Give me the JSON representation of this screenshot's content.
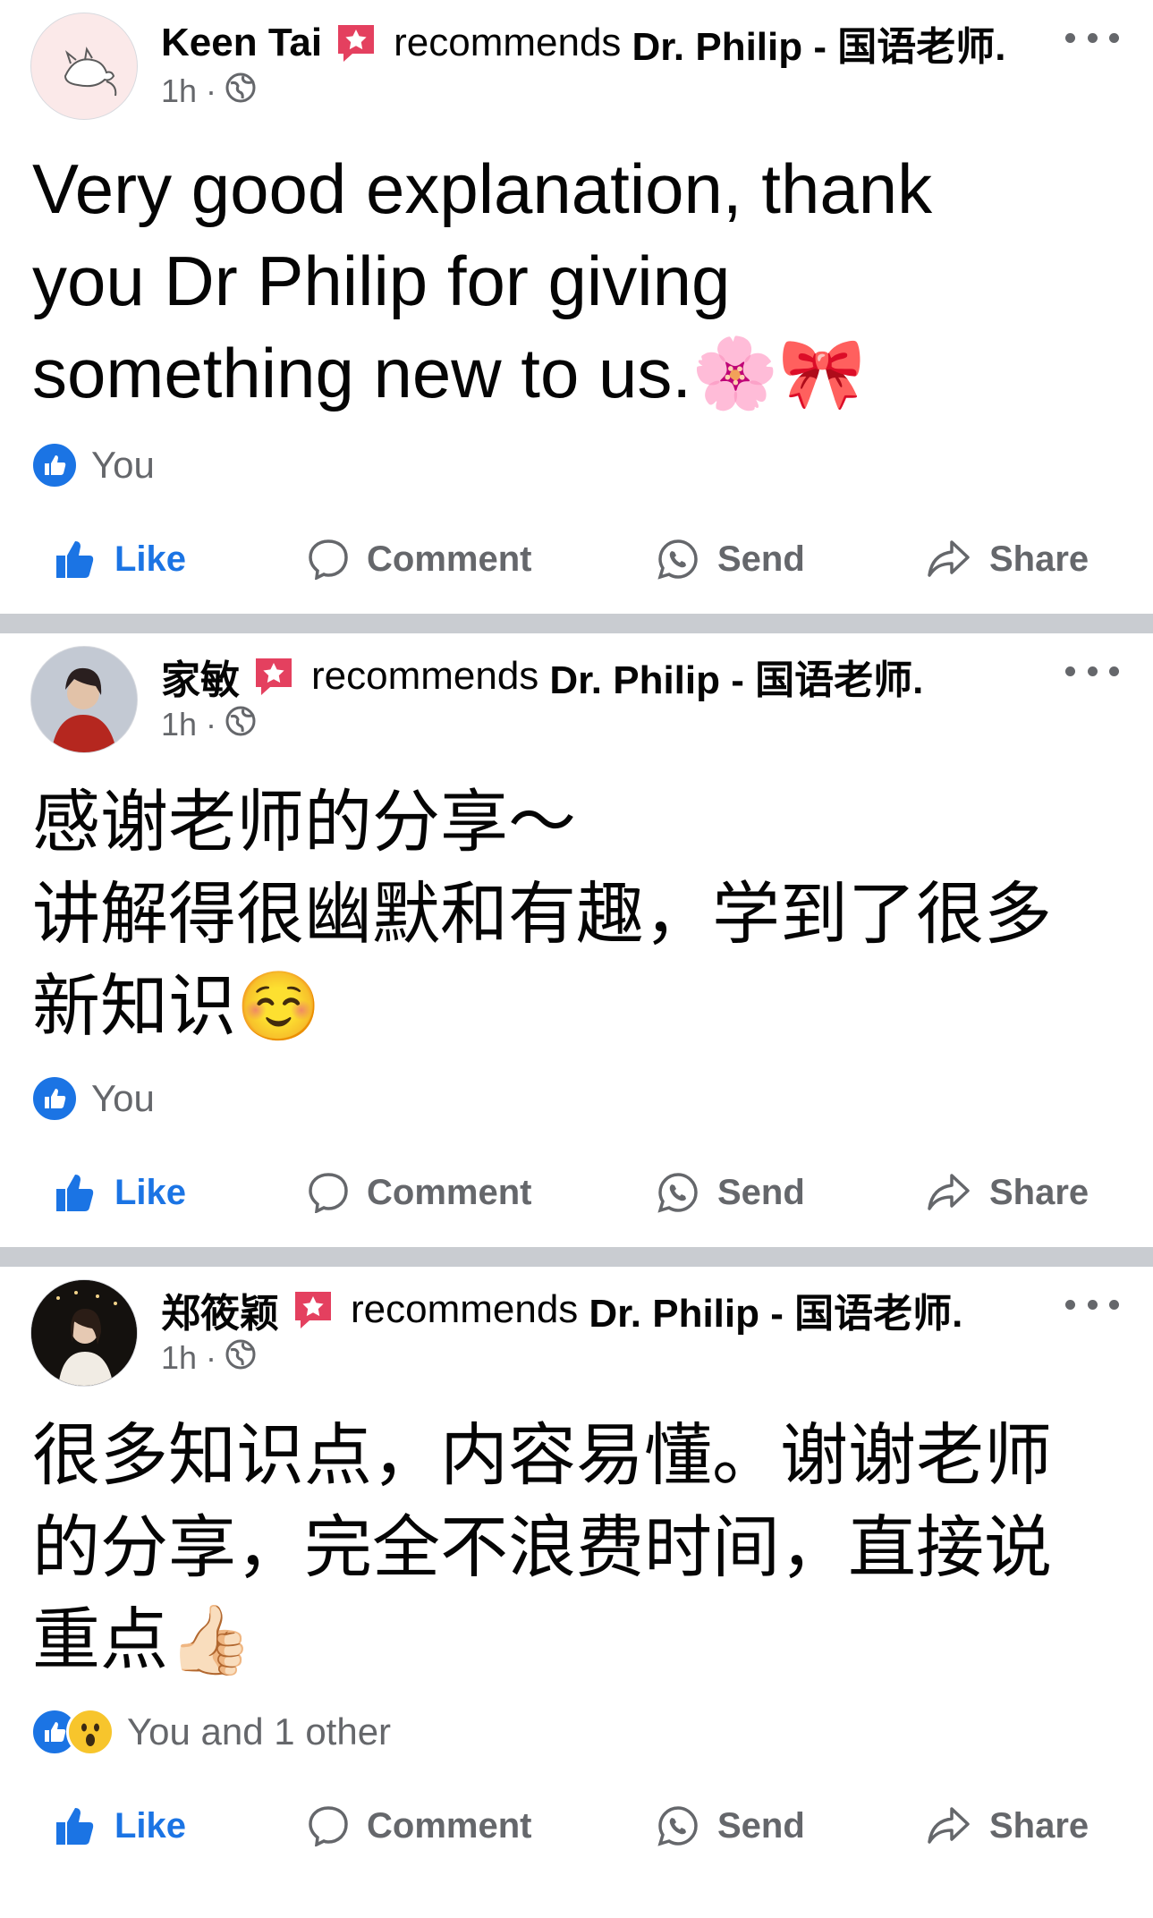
{
  "colors": {
    "like_blue": "#1b74e4",
    "gray_text": "#65676b",
    "badge_red": "#e4405f",
    "divider": "#c9ccd1"
  },
  "common": {
    "verb": "recommends",
    "page": "Dr. Philip - 国语老师.",
    "dot": "·"
  },
  "posts": [
    {
      "author": "Keen Tai",
      "time": "1h",
      "text": "Very good explanation, thank\nyou Dr Philip for giving\nsomething new to us.🌸🎀",
      "reactions": [
        "like"
      ],
      "reaction_text": "You",
      "actions": {
        "like": "Like",
        "comment": "Comment",
        "send": "Send",
        "share": "Share"
      }
    },
    {
      "author": "家敏",
      "time": "1h",
      "text": "感谢老师的分享～\n讲解得很幽默和有趣，学到了很多\n新知识☺️",
      "reactions": [
        "like"
      ],
      "reaction_text": "You",
      "actions": {
        "like": "Like",
        "comment": "Comment",
        "send": "Send",
        "share": "Share"
      }
    },
    {
      "author": "郑筱颖",
      "time": "1h",
      "text": "很多知识点，内容易懂。谢谢老师\n的分享，完全不浪费时间，直接说\n重点👍🏻",
      "reactions": [
        "like",
        "wow"
      ],
      "reaction_text": "You and 1 other",
      "actions": {
        "like": "Like",
        "comment": "Comment",
        "send": "Send",
        "share": "Share"
      }
    }
  ]
}
